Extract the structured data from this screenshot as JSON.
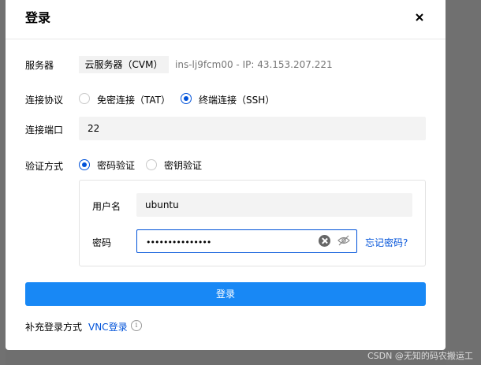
{
  "dialog": {
    "title": "登录",
    "close_icon": "close-icon"
  },
  "server": {
    "label": "服务器",
    "tag": "云服务器（CVM）",
    "info": "ins-lj9fcm00 - IP: 43.153.207.221"
  },
  "protocol": {
    "label": "连接协议",
    "options": [
      "免密连接（TAT）",
      "终端连接（SSH）"
    ],
    "selected": "终端连接（SSH）"
  },
  "port": {
    "label": "连接端口",
    "value": "22"
  },
  "auth": {
    "label": "验证方式",
    "options": [
      "密码验证",
      "密钥验证"
    ],
    "selected": "密码验证",
    "username_label": "用户名",
    "username_value": "ubuntu",
    "password_label": "密码",
    "password_value": "•••••••••••••••",
    "forgot_link": "忘记密码?"
  },
  "login_button": "登录",
  "footer": {
    "label": "补充登录方式",
    "vnc_link": "VNC登录"
  },
  "watermark": "CSDN @无知的码农搬运工",
  "colors": {
    "primary": "#1888f5",
    "link": "#0052d9"
  }
}
